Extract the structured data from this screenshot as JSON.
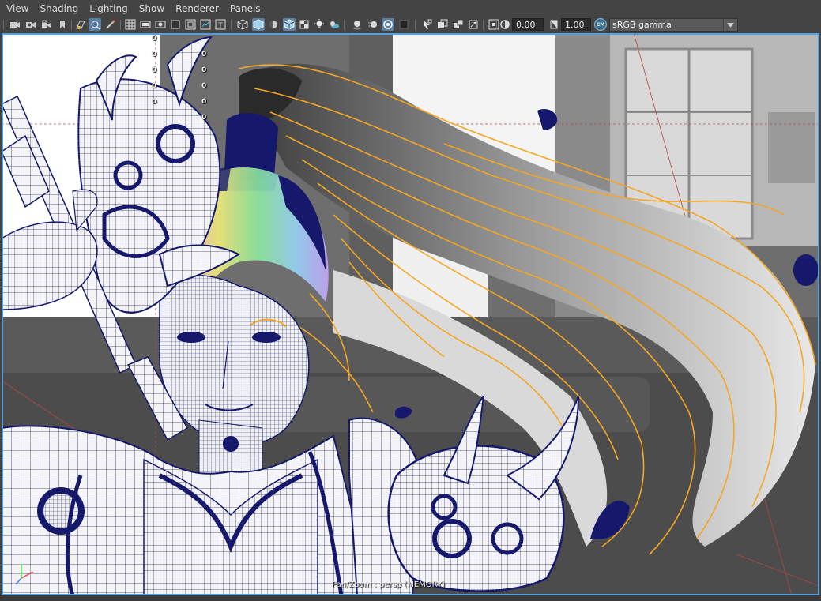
{
  "menubar": {
    "items": [
      "View",
      "Shading",
      "Lighting",
      "Show",
      "Renderer",
      "Panels"
    ]
  },
  "toolbar": {
    "exposure_value": "0.00",
    "gamma_value": "1.00",
    "color_space": "sRGB gamma",
    "icons": [
      "select-camera-icon",
      "camera-attributes-icon",
      "bookmarks-icon",
      "image-plane-icon",
      "grid-icon",
      "film-gate-icon",
      "resolution-gate-icon",
      "gate-mask-icon",
      "safe-action-icon",
      "wireframe-icon",
      "smooth-shade-icon",
      "default-lighting-icon",
      "textured-icon",
      "use-all-lights-icon",
      "shadows-icon",
      "ambient-occlusion-icon",
      "motion-blur-icon",
      "anti-aliasing-icon",
      "isolate-select-icon",
      "xray-icon",
      "xray-joints-icon",
      "backface-culling-icon",
      "exposure-icon",
      "gamma-icon",
      "color-management-icon"
    ]
  },
  "viewport": {
    "hud_values": [
      "0",
      "0",
      "0",
      "0",
      "0"
    ],
    "hud_values_left": [
      "0",
      "0",
      "0",
      "0",
      "0"
    ],
    "camera_label": "Pan/Zoom : persp  (MEMORY)"
  },
  "colors": {
    "ui_background": "#444444",
    "active_icon": "#5c7fa3",
    "viewport_border": "#5aa0d8",
    "wireframe": "#15186b",
    "guide_curves": "#f5a623"
  }
}
